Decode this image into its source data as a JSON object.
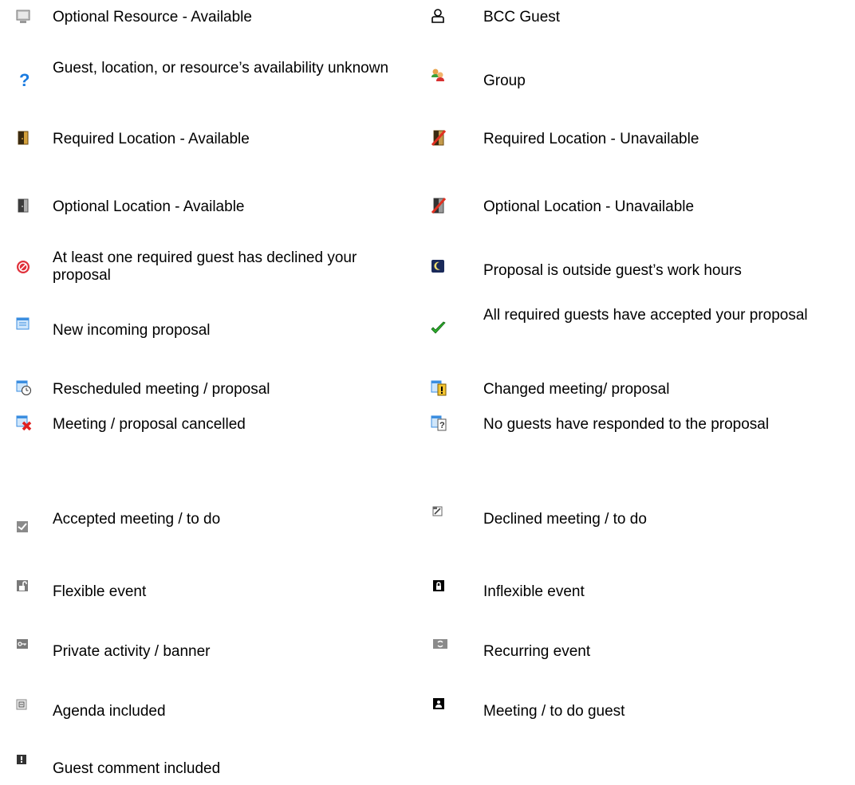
{
  "legend": {
    "left": [
      {
        "icon": "optional-resource-available-icon",
        "label": "Optional Resource - Available"
      },
      {
        "icon": "availability-unknown-icon",
        "label": "Guest, location, or resource’s availability unknown"
      },
      {
        "icon": "required-location-available-icon",
        "label": "Required Location - Available"
      },
      {
        "icon": "optional-location-available-icon",
        "label": "Optional Location - Available"
      },
      {
        "icon": "declined-proposal-icon",
        "label": "At least one required guest has declined your proposal"
      },
      {
        "icon": "new-incoming-proposal-icon",
        "label": "New incoming proposal"
      },
      {
        "icon": "rescheduled-meeting-icon",
        "label": "Rescheduled meeting / proposal"
      },
      {
        "icon": "meeting-cancelled-icon",
        "label": "Meeting / proposal cancelled"
      },
      {
        "icon": "accepted-meeting-icon",
        "label": "Accepted meeting / to do"
      },
      {
        "icon": "flexible-event-icon",
        "label": "Flexible event"
      },
      {
        "icon": "private-activity-icon",
        "label": "Private activity / banner"
      },
      {
        "icon": "agenda-included-icon",
        "label": "Agenda included"
      },
      {
        "icon": "guest-comment-icon",
        "label": "Guest comment included"
      }
    ],
    "right": [
      {
        "icon": "bcc-guest-icon",
        "label": "BCC Guest"
      },
      {
        "icon": "group-icon",
        "label": "Group"
      },
      {
        "icon": "required-location-unavailable-icon",
        "label": "Required Location - Unavailable"
      },
      {
        "icon": "optional-location-unavailable-icon",
        "label": "Optional Location - Unavailable"
      },
      {
        "icon": "outside-work-hours-icon",
        "label": "Proposal is outside guest’s work hours"
      },
      {
        "icon": "all-accepted-icon",
        "label": "All required guests have accepted your proposal"
      },
      {
        "icon": "changed-meeting-icon",
        "label": "Changed meeting/ proposal"
      },
      {
        "icon": "no-response-icon",
        "label": "No guests have responded to the proposal"
      },
      {
        "icon": "declined-meeting-icon",
        "label": "Declined meeting / to do"
      },
      {
        "icon": "inflexible-event-icon",
        "label": "Inflexible event"
      },
      {
        "icon": "recurring-event-icon",
        "label": "Recurring event"
      },
      {
        "icon": "meeting-guest-icon",
        "label": "Meeting / to do guest"
      }
    ]
  }
}
